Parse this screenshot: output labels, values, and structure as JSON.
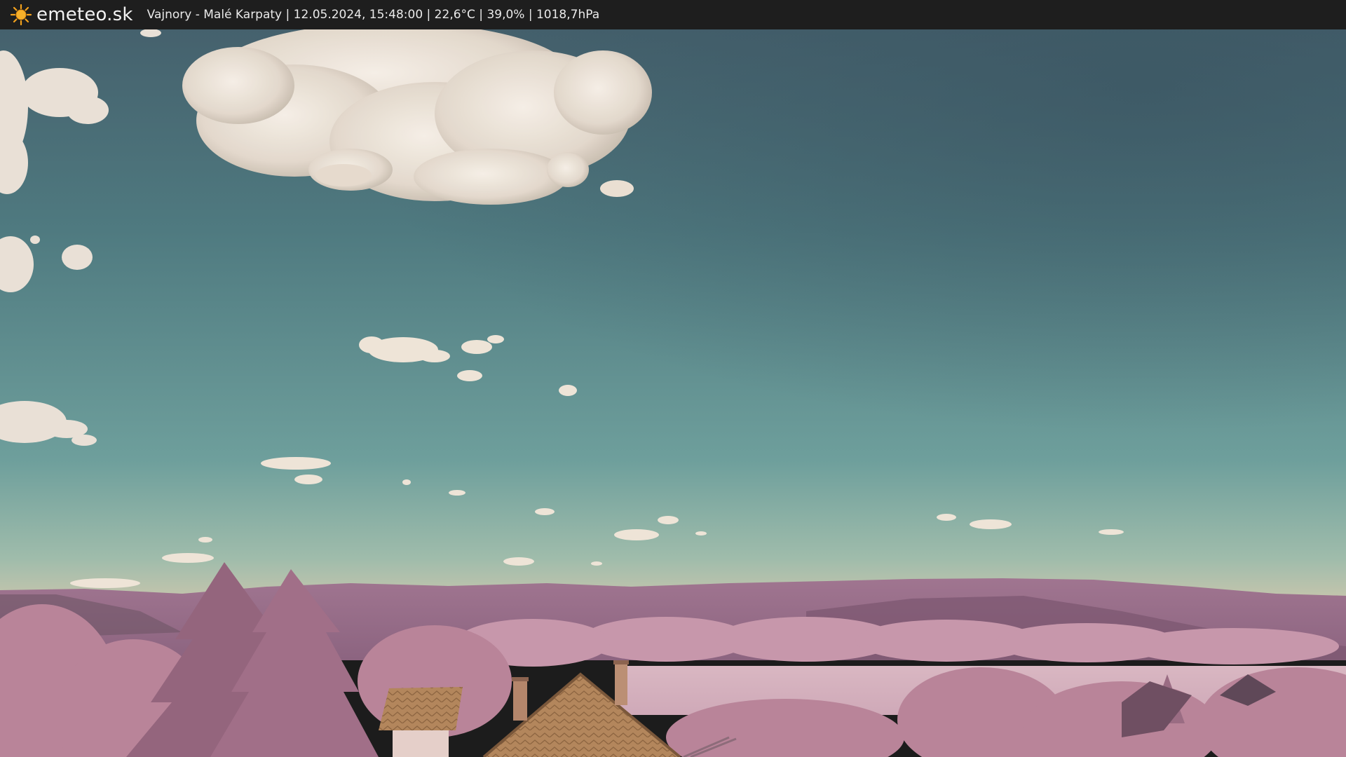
{
  "header": {
    "brand": "emeteo.sk",
    "logo_icon": "sun-icon",
    "caption": "Vajnory - Malé Karpaty | 12.05.2024, 15:48:00 | 22,6°C | 39,0% | 1018,7hPa"
  },
  "colors": {
    "bar": "#1e1e1e",
    "sun": "#f4a21c",
    "sky_top": "#3f5a66",
    "sky_bottom": "#75a4a0",
    "foliage": "#b47f96",
    "roof": "#b5875e"
  }
}
